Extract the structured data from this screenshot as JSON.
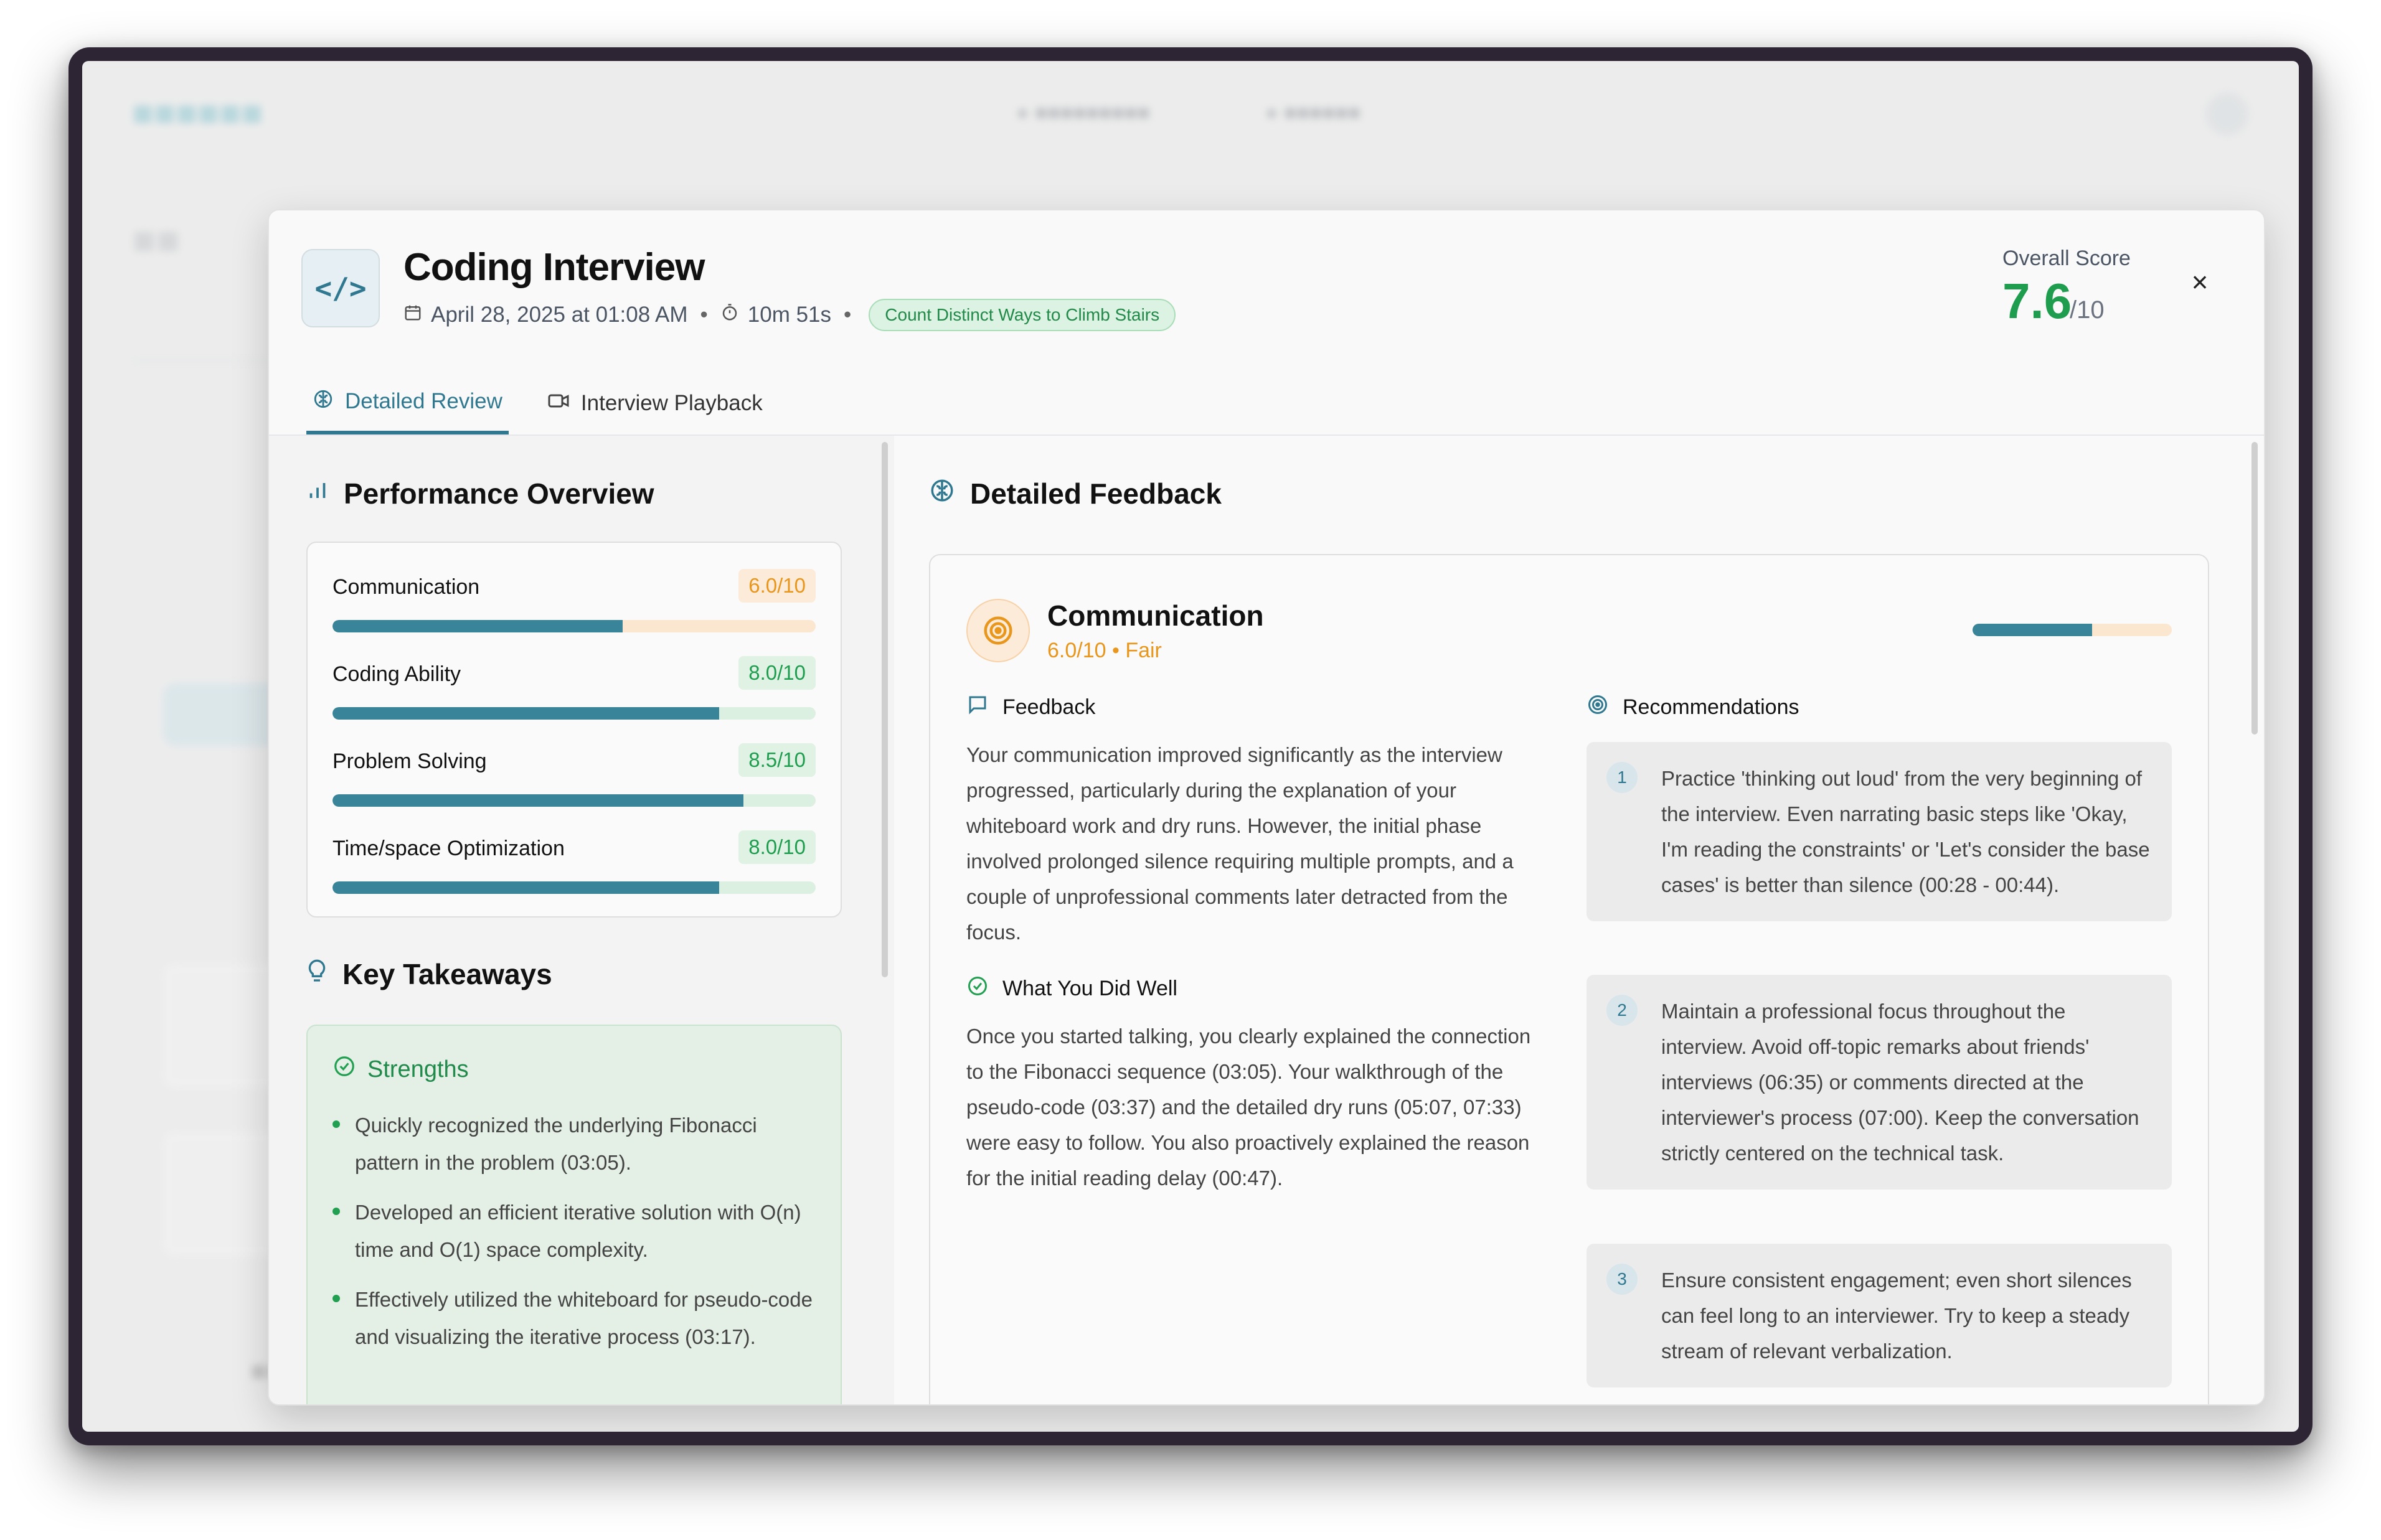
{
  "modal": {
    "title": "Coding Interview",
    "date": "April 28, 2025 at 01:08 AM",
    "duration": "10m 51s",
    "problem_tag": "Count Distinct Ways to Climb Stairs",
    "overall_label": "Overall Score",
    "overall_score": "7.6",
    "overall_max": "/10",
    "close_glyph": "×",
    "tabs": [
      {
        "label": "Detailed Review",
        "active": true
      },
      {
        "label": "Interview Playback",
        "active": false
      }
    ]
  },
  "performance": {
    "title": "Performance Overview",
    "metrics": [
      {
        "name": "Communication",
        "score": "6.0/10",
        "fraction": 0.6,
        "status_color": "#e8961c"
      },
      {
        "name": "Coding Ability",
        "score": "8.0/10",
        "fraction": 0.8,
        "status_color": "#1f9d4f"
      },
      {
        "name": "Problem Solving",
        "score": "8.5/10",
        "fraction": 0.85,
        "status_color": "#1f9d4f"
      },
      {
        "name": "Time/space Optimization",
        "score": "8.0/10",
        "fraction": 0.8,
        "status_color": "#1f9d4f"
      }
    ]
  },
  "takeaways": {
    "title": "Key Takeaways",
    "strengths_title": "Strengths",
    "strengths": [
      "Quickly recognized the underlying Fibonacci pattern in the problem (03:05).",
      "Developed an efficient iterative solution with O(n) time and O(1) space complexity.",
      "Effectively utilized the whiteboard for pseudo-code and visualizing the iterative process (03:17)."
    ]
  },
  "feedback": {
    "title": "Detailed Feedback",
    "category": "Communication",
    "category_score": "6.0/10 • Fair",
    "category_fraction": 0.6,
    "feedback_heading": "Feedback",
    "feedback_text": "Your communication improved significantly as the interview progressed, particularly during the explanation of your whiteboard work and dry runs. However, the initial phase involved prolonged silence requiring multiple prompts, and a couple of unprofessional comments later detracted from the focus.",
    "did_well_heading": "What You Did Well",
    "did_well_text": "Once you started talking, you clearly explained the connection to the Fibonacci sequence (03:05). Your walkthrough of the pseudo-code (03:37) and the detailed dry runs (05:07, 07:33) were easy to follow. You also proactively explained the reason for the initial reading delay (00:47).",
    "recommendations_heading": "Recommendations",
    "recommendations": [
      {
        "num": "1",
        "text": "Practice 'thinking out loud' from the very beginning of the interview. Even narrating basic steps like 'Okay, I'm reading the constraints' or 'Let's consider the base cases' is better than silence (00:28 - 00:44)."
      },
      {
        "num": "2",
        "text": "Maintain a professional focus throughout the interview. Avoid off-topic remarks about friends' interviews (06:35) or comments directed at the interviewer's process (07:00). Keep the conversation strictly centered on the technical task."
      },
      {
        "num": "3",
        "text": "Ensure consistent engagement; even short silences can feel long to an interviewer. Try to keep a steady stream of relevant verbalization."
      }
    ]
  },
  "colors": {
    "accent": "#2f7890",
    "success": "#1f9d4f",
    "warning": "#e8961c"
  }
}
